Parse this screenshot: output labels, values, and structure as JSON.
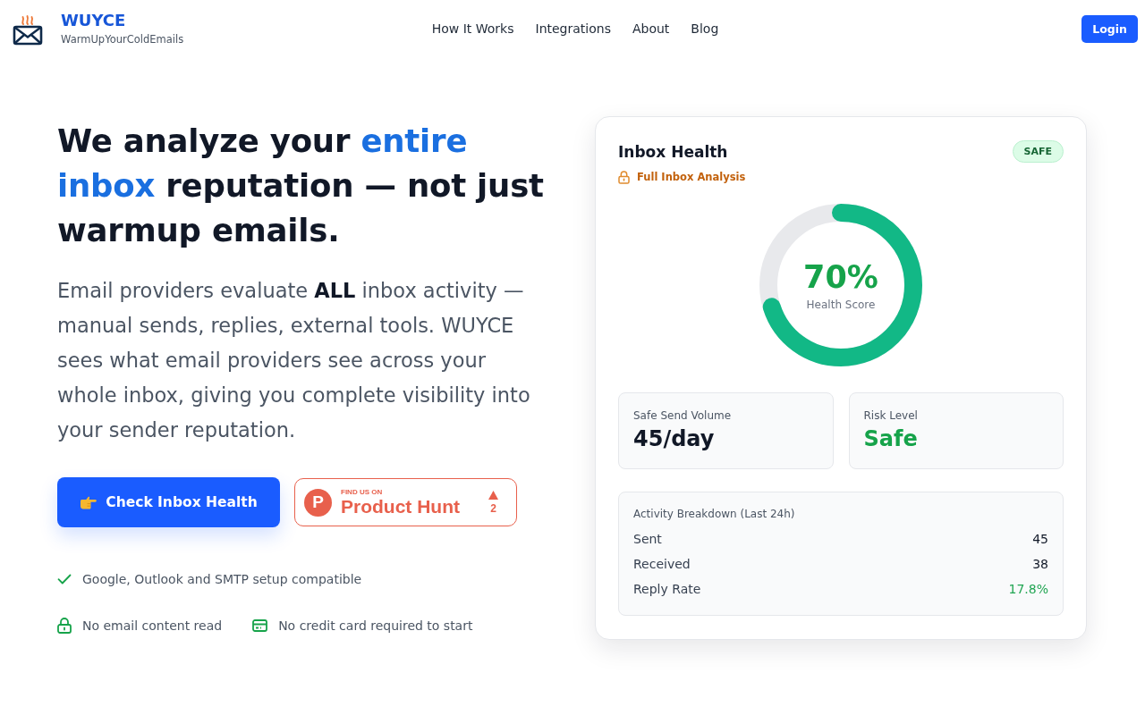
{
  "header": {
    "logo": {
      "name": "WUYCE",
      "tagline": "WarmUpYourColdEmails"
    },
    "nav": [
      "How It Works",
      "Integrations",
      "About",
      "Blog"
    ],
    "login": "Login"
  },
  "hero": {
    "headline": [
      {
        "text": "We analyze your ",
        "highlight": false
      },
      {
        "text": "entire inbox",
        "highlight": true
      },
      {
        "text": " reputation — not just warmup emails.",
        "highlight": false
      }
    ],
    "description": "Email providers evaluate **ALL** inbox activity — manual sends, replies, external tools. WUYCE sees what email providers see across your whole inbox, giving you complete visibility into your sender reputation.",
    "cta": "Check Inbox Health",
    "badge": {
      "logo": "P",
      "eyebrow": "FIND US ON",
      "name": "Product Hunt",
      "upvotes": "2"
    },
    "feature_rows": [
      [
        {
          "kind": "check",
          "text": "Google, Outlook and SMTP setup compatible"
        }
      ],
      [
        {
          "kind": "lock",
          "text": "No email content read"
        },
        {
          "kind": "card",
          "text": "No credit card required to start"
        }
      ]
    ]
  },
  "health_card": {
    "title": "Inbox Health",
    "status": "SAFE",
    "subtitle": "Full Inbox Analysis",
    "score": {
      "value": "70%",
      "label": "Health Score",
      "level": 0.7
    },
    "stats": [
      {
        "label": "Safe Send Volume",
        "value": "45/day",
        "color": "#111827"
      },
      {
        "label": "Risk Level",
        "value": "Safe",
        "color": "#16a34a"
      }
    ],
    "activity": {
      "title": "Activity Breakdown (Last 24h)",
      "rows": [
        {
          "label": "Sent",
          "value": "45",
          "color": "#111827"
        },
        {
          "label": "Received",
          "value": "38",
          "color": "#111827"
        },
        {
          "label": "Reply Rate",
          "value": "17.8%",
          "color": "#22a553"
        }
      ]
    }
  }
}
